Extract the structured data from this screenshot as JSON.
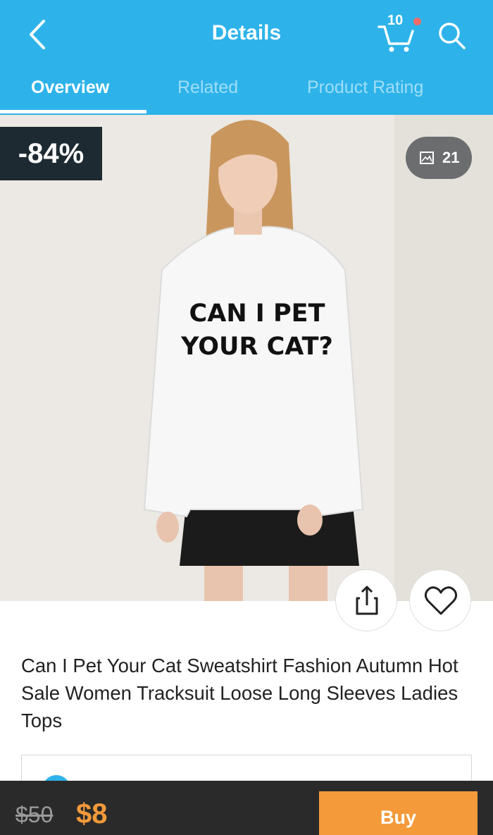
{
  "header": {
    "title": "Details",
    "back_icon": "chevron-left-icon",
    "cart": {
      "icon": "cart-icon",
      "count": "10",
      "has_notification": true
    },
    "search_icon": "search-icon"
  },
  "tabs": [
    {
      "label": "Overview",
      "active": true
    },
    {
      "label": "Related",
      "active": false
    },
    {
      "label": "Product Rating",
      "active": false
    }
  ],
  "product": {
    "image_icon": "sweatshirt-photo",
    "sweatshirt_print": [
      "CAN I PET",
      "YOUR CAT?"
    ],
    "discount": "-84%",
    "gallery_count": "21",
    "title": "Can I Pet Your Cat Sweatshirt Fashion Autumn Hot Sale Women Tracksuit  Loose Long Sleeves Ladies Tops"
  },
  "actions": {
    "share_icon": "share-icon",
    "favorite_icon": "heart-icon"
  },
  "bottom_bar": {
    "old_price": "$50",
    "new_price": "$8",
    "buy_label": "Buy"
  },
  "colors": {
    "header_bg": "#2db3ea",
    "accent": "#f49a3b",
    "bar_bg": "#2a2a2a",
    "badge_bg": "#1e2a32"
  }
}
